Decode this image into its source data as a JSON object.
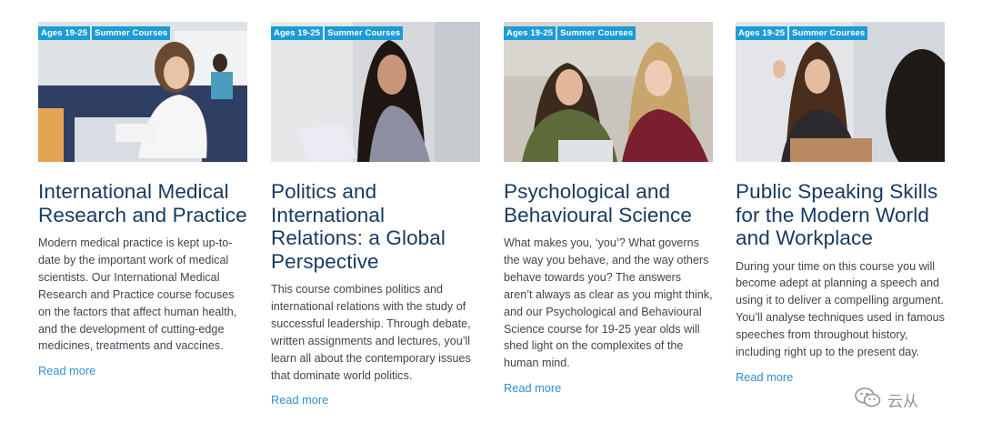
{
  "cards": [
    {
      "tags": [
        "Ages 19-25",
        "Summer Courses"
      ],
      "title": "International Medical Research and Practice",
      "description": "Modern medical practice is kept up-to-date by the important work of medical scientists. Our International Medical Research and Practice course focuses on the factors that affect human health, and the development of cutting-edge medicines, treatments and vaccines.",
      "link": "Read more"
    },
    {
      "tags": [
        "Ages 19-25",
        "Summer Courses"
      ],
      "title": "Politics and International Relations: a Global Perspective",
      "description": "This course combines politics and international relations with the study of successful leadership. Through debate, written assignments and lectures, you’ll learn all about the contemporary issues that dominate world politics.",
      "link": "Read more"
    },
    {
      "tags": [
        "Ages 19-25",
        "Summer Courses"
      ],
      "title": "Psychological and Behavioural Science",
      "description": "What makes you, ‘you’? What governs the way you behave, and the way others behave towards you? The answers aren’t always as clear as you might think, and our Psychological and Behavioural Science course for 19-25 year olds will shed light on the complexites of the human mind.",
      "link": "Read more"
    },
    {
      "tags": [
        "Ages 19-25",
        "Summer Courses"
      ],
      "title": "Public Speaking Skills for the Modern World and Workplace",
      "description": "During your time on this course you will become adept at planning a speech and using it to deliver a compelling argument. You’ll analyse techniques used in famous speeches from throughout history, including right up to the present day.",
      "link": "Read more"
    }
  ],
  "watermark": {
    "text": "云从",
    "icon": "wechat-icon"
  },
  "colors": {
    "tag_bg": "#1c9cd6",
    "title": "#163a5f",
    "link": "#2f8fd0",
    "body": "#3d4651"
  }
}
